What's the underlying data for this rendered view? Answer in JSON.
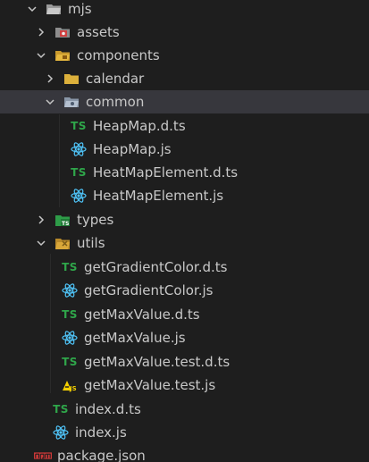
{
  "explorer": {
    "tree": [
      {
        "label": "mjs",
        "type": "folder",
        "expanded": true,
        "icon": "folder-open-icon"
      },
      {
        "label": "assets",
        "type": "folder",
        "expanded": false,
        "icon": "folder-assets-icon"
      },
      {
        "label": "components",
        "type": "folder",
        "expanded": true,
        "icon": "folder-components-icon"
      },
      {
        "label": "calendar",
        "type": "folder",
        "expanded": false,
        "icon": "folder-icon"
      },
      {
        "label": "common",
        "type": "folder",
        "expanded": true,
        "selected": true,
        "icon": "folder-common-icon"
      },
      {
        "label": "HeapMap.d.ts",
        "type": "file",
        "icon": "typescript-icon"
      },
      {
        "label": "HeapMap.js",
        "type": "file",
        "icon": "react-icon"
      },
      {
        "label": "HeatMapElement.d.ts",
        "type": "file",
        "icon": "typescript-icon"
      },
      {
        "label": "HeatMapElement.js",
        "type": "file",
        "icon": "react-icon"
      },
      {
        "label": "types",
        "type": "folder",
        "expanded": false,
        "icon": "folder-types-icon"
      },
      {
        "label": "utils",
        "type": "folder",
        "expanded": true,
        "icon": "folder-utils-icon"
      },
      {
        "label": "getGradientColor.d.ts",
        "type": "file",
        "icon": "typescript-icon"
      },
      {
        "label": "getGradientColor.js",
        "type": "file",
        "icon": "react-icon"
      },
      {
        "label": "getMaxValue.d.ts",
        "type": "file",
        "icon": "typescript-icon"
      },
      {
        "label": "getMaxValue.js",
        "type": "file",
        "icon": "react-icon"
      },
      {
        "label": "getMaxValue.test.d.ts",
        "type": "file",
        "icon": "typescript-icon"
      },
      {
        "label": "getMaxValue.test.js",
        "type": "file",
        "icon": "test-js-icon"
      },
      {
        "label": "index.d.ts",
        "type": "file",
        "icon": "typescript-icon"
      },
      {
        "label": "index.js",
        "type": "file",
        "icon": "react-icon"
      },
      {
        "label": "package.json",
        "type": "file",
        "icon": "npm-icon"
      }
    ],
    "ts_glyph": "TS",
    "colors": {
      "background": "#1e1e1e",
      "selected_row": "#37373d",
      "text": "#c8c8c8",
      "typescript": "#2fa64a",
      "react": "#4fc3f7",
      "folder": "#dcb03b",
      "npm": "#cb3837"
    }
  }
}
